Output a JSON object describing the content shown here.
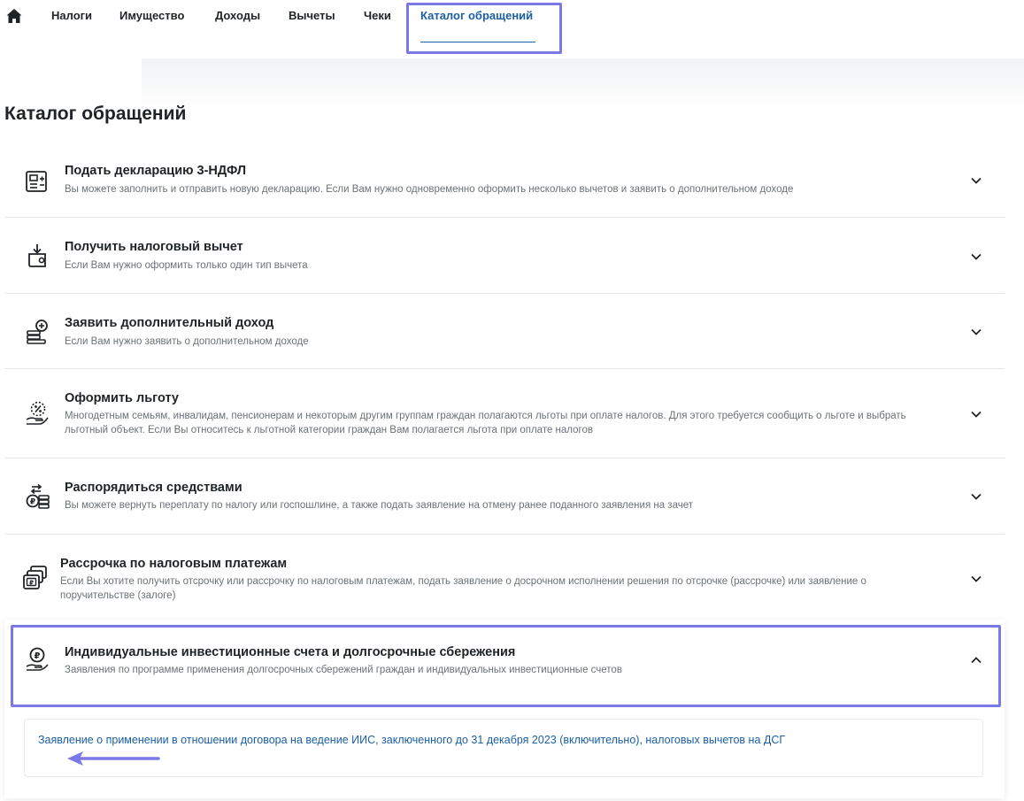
{
  "nav": {
    "items": [
      {
        "label": "Налоги"
      },
      {
        "label": "Имущество"
      },
      {
        "label": "Доходы"
      },
      {
        "label": "Вычеты"
      },
      {
        "label": "Чеки"
      },
      {
        "label": "Каталог обращений"
      }
    ],
    "active_index": 5
  },
  "page": {
    "title": "Каталог обращений"
  },
  "items": [
    {
      "title": "Подать декларацию 3-НДФЛ",
      "description": "Вы можете заполнить и отправить новую декларацию. Если Вам нужно одновременно оформить несколько вычетов и заявить о дополнительном доходе",
      "icon": "declaration-icon",
      "expanded": false
    },
    {
      "title": "Получить налоговый вычет",
      "description": "Если Вам нужно оформить только один тип вычета",
      "icon": "wallet-download-icon",
      "expanded": false
    },
    {
      "title": "Заявить дополнительный доход",
      "description": "Если Вам нужно заявить о дополнительном доходе",
      "icon": "coins-plus-icon",
      "expanded": false
    },
    {
      "title": "Оформить льготу",
      "description": "Многодетным семьям, инвалидам, пенсионерам и некоторым другим группам граждан полагаются льготы при оплате налогов. Для этого требуется сообщить о льготе и выбрать льготный объект. Если Вы относитесь к льготной категории граждан Вам полагается льгота при оплате налогов",
      "icon": "percent-hand-icon",
      "expanded": false
    },
    {
      "title": "Распорядиться средствами",
      "description": "Вы можете вернуть переплату по налогу или госпошлине, а также подать заявление на отмену ранее поданного заявления на зачет",
      "icon": "exchange-coins-icon",
      "expanded": false
    },
    {
      "title": "Рассрочка по налоговым платежам",
      "description": "Если Вы хотите получить отсрочку или рассрочку по налоговым платежам, подать заявление о досрочном исполнении решения по отсрочке (рассрочке) или заявление о поручительстве (залоге)",
      "icon": "payment-cards-icon",
      "expanded": false
    },
    {
      "title": "Индивидуальные инвестиционные счета и долгосрочные сбережения",
      "description": "Заявления по программе применения долгосрочных сбережений граждан и индивидуальных инвестиционные счетов",
      "icon": "ruble-hand-icon",
      "expanded": true,
      "sub_items": [
        {
          "label": "Заявление о применении в отношении договора на ведение ИИС, заключенного до 31 декабря 2023 (включительно), налоговых вычетов на ДСГ"
        }
      ]
    }
  ],
  "colors": {
    "accent": "#1a5fa6",
    "highlight": "#7b78e8",
    "text": "#1f2328",
    "muted": "#6b717a",
    "divider": "#e3e6ea"
  }
}
